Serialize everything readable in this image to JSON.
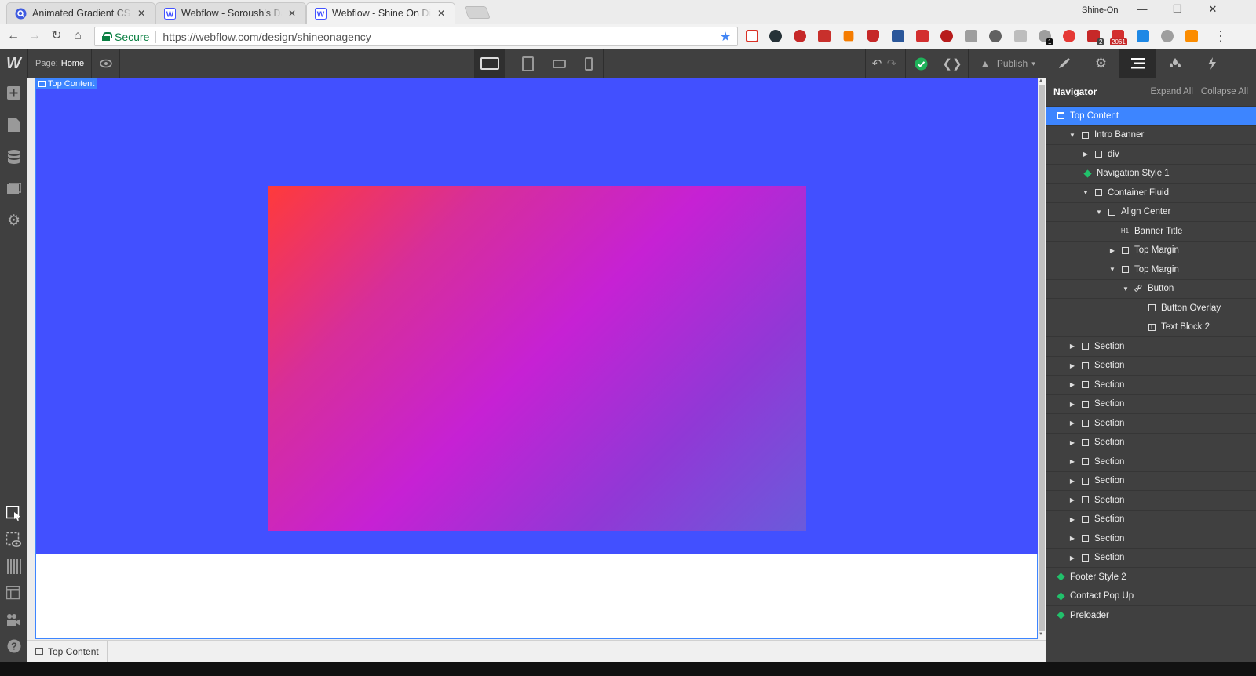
{
  "browser": {
    "tabs": [
      {
        "title": "Animated Gradient CSS -",
        "icon": "search-favicon-icon",
        "active": false
      },
      {
        "title": "Webflow - Soroush's Dap",
        "icon": "webflow-favicon-icon",
        "active": false
      },
      {
        "title": "Webflow - Shine On Digit",
        "icon": "webflow-favicon-icon",
        "active": true
      }
    ],
    "profile": "Shine-On",
    "secure_label": "Secure",
    "url": "https://webflow.com/design/shineonagency",
    "extension_badges": [
      "1",
      "2",
      "2061"
    ]
  },
  "designer": {
    "page_label": "Page:",
    "page_name": "Home",
    "publish_label": "Publish"
  },
  "canvas": {
    "selected_label": "Top Content",
    "colors": {
      "section_bg": "#4250ff",
      "accent": "#3d85ff"
    }
  },
  "breadcrumb": {
    "item": "Top Content"
  },
  "navigator": {
    "title": "Navigator",
    "expand_all": "Expand All",
    "collapse_all": "Collapse All",
    "nodes": [
      {
        "label": "Top Content",
        "type": "section"
      },
      {
        "label": "Intro Banner",
        "type": "div"
      },
      {
        "label": "div",
        "type": "div"
      },
      {
        "label": "Navigation Style 1",
        "type": "symbol"
      },
      {
        "label": "Container Fluid",
        "type": "div"
      },
      {
        "label": "Align Center",
        "type": "div"
      },
      {
        "label": "Banner Title",
        "type": "heading",
        "icon_text": "H1"
      },
      {
        "label": "Top Margin",
        "type": "div"
      },
      {
        "label": "Top Margin",
        "type": "div"
      },
      {
        "label": "Button",
        "type": "link"
      },
      {
        "label": "Button Overlay",
        "type": "div"
      },
      {
        "label": "Text Block 2",
        "type": "text"
      },
      {
        "label": "Section",
        "type": "div"
      },
      {
        "label": "Section",
        "type": "div"
      },
      {
        "label": "Section",
        "type": "div"
      },
      {
        "label": "Section",
        "type": "div"
      },
      {
        "label": "Section",
        "type": "div"
      },
      {
        "label": "Section",
        "type": "div"
      },
      {
        "label": "Section",
        "type": "div"
      },
      {
        "label": "Section",
        "type": "div"
      },
      {
        "label": "Section",
        "type": "div"
      },
      {
        "label": "Section",
        "type": "div"
      },
      {
        "label": "Section",
        "type": "div"
      },
      {
        "label": "Section",
        "type": "div"
      },
      {
        "label": "Footer Style 2",
        "type": "symbol"
      },
      {
        "label": "Contact Pop Up",
        "type": "symbol"
      },
      {
        "label": "Preloader",
        "type": "symbol"
      }
    ]
  }
}
